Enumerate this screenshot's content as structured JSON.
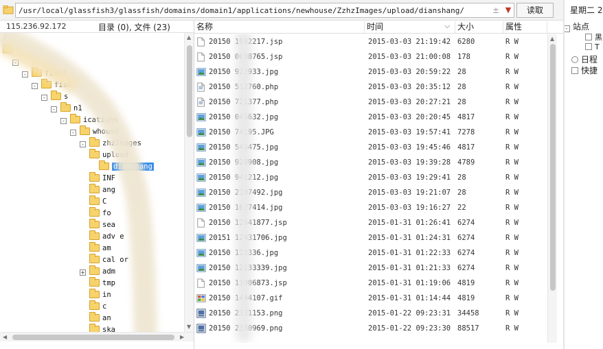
{
  "pathbar": {
    "path": "/usr/local/glassfish3/glassfish/domains/domain1/applications/newhouse/ZzhzImages/upload/dianshang/",
    "sync_icon": "sync-icon",
    "dropdown_icon": "chevron-down-icon",
    "read_button": "读取"
  },
  "left": {
    "server_ip": "115.236.92.172",
    "summary": "目录 (0), 文件 (23)"
  },
  "tree": [
    {
      "label": "/",
      "indent": 0,
      "expander": "",
      "folder": false
    },
    {
      "label": "",
      "indent": 0,
      "expander": "",
      "folder": true
    },
    {
      "label": "",
      "indent": 1,
      "expander": "-",
      "folder": false
    },
    {
      "label": "fish3",
      "indent": 2,
      "expander": "-",
      "folder": true
    },
    {
      "label": "fish",
      "indent": 3,
      "expander": "-",
      "folder": true
    },
    {
      "label": "s",
      "indent": 4,
      "expander": "-",
      "folder": true
    },
    {
      "label": "n1",
      "indent": 5,
      "expander": "-",
      "folder": true
    },
    {
      "label": "ications",
      "indent": 6,
      "expander": "-",
      "folder": true
    },
    {
      "label": "whouse",
      "indent": 7,
      "expander": "-",
      "folder": true
    },
    {
      "label": "zhzImages",
      "indent": 8,
      "expander": "-",
      "folder": true
    },
    {
      "label": "upload",
      "indent": 9,
      "expander": "",
      "folder": true
    },
    {
      "label": "dianshang",
      "indent": 10,
      "expander": "",
      "folder": true,
      "selected": true
    },
    {
      "label": "INF",
      "indent": 9,
      "expander": "",
      "folder": true
    },
    {
      "label": "ang",
      "indent": 9,
      "expander": "",
      "folder": true
    },
    {
      "label": "C",
      "indent": 9,
      "expander": "",
      "folder": true
    },
    {
      "label": "fo",
      "indent": 9,
      "expander": "",
      "folder": true
    },
    {
      "label": "sea",
      "indent": 9,
      "expander": "",
      "folder": true
    },
    {
      "label": "adv    e",
      "indent": 9,
      "expander": "",
      "folder": true
    },
    {
      "label": "am",
      "indent": 9,
      "expander": "",
      "folder": true
    },
    {
      "label": "cal    or",
      "indent": 9,
      "expander": "",
      "folder": true
    },
    {
      "label": "adm",
      "indent": 8,
      "expander": "+",
      "folder": true
    },
    {
      "label": "tmp",
      "indent": 9,
      "expander": "",
      "folder": true
    },
    {
      "label": "in",
      "indent": 9,
      "expander": "",
      "folder": true
    },
    {
      "label": "c",
      "indent": 9,
      "expander": "",
      "folder": true
    },
    {
      "label": "an",
      "indent": 9,
      "expander": "",
      "folder": true
    },
    {
      "label": "ska",
      "indent": 9,
      "expander": "",
      "folder": true
    }
  ],
  "columns": {
    "name": "名称",
    "time": "时间",
    "size": "大小",
    "attr": "属性",
    "sort_icon": "chevron-down-icon"
  },
  "files": [
    {
      "name": "20150    1942217.jsp",
      "time": "2015-03-03 21:19:42",
      "size": "6280",
      "attr": "R W",
      "icon": "file-icon"
    },
    {
      "name": "20150    0008765.jsp",
      "time": "2015-03-03 21:00:08",
      "size": "178",
      "attr": "R W",
      "icon": "file-icon"
    },
    {
      "name": "20150    922933.jpg",
      "time": "2015-03-03 20:59:22",
      "size": "28",
      "attr": "R W",
      "icon": "image-icon"
    },
    {
      "name": "20150    512760.php",
      "time": "2015-03-03 20:35:12",
      "size": "28",
      "attr": "R W",
      "icon": "script-file-icon"
    },
    {
      "name": "20150    721377.php",
      "time": "2015-03-03 20:27:21",
      "size": "28",
      "attr": "R W",
      "icon": "script-file-icon"
    },
    {
      "name": "20150    045632.jpg",
      "time": "2015-03-03 20:20:45",
      "size": "4817",
      "attr": "R W",
      "icon": "image-icon"
    },
    {
      "name": "20150    74195.JPG",
      "time": "2015-03-03 19:57:41",
      "size": "7278",
      "attr": "R W",
      "icon": "image-icon"
    },
    {
      "name": "20150    546475.jpg",
      "time": "2015-03-03 19:45:46",
      "size": "4817",
      "attr": "R W",
      "icon": "image-icon"
    },
    {
      "name": "20150    928908.jpg",
      "time": "2015-03-03 19:39:28",
      "size": "4789",
      "attr": "R W",
      "icon": "image-icon"
    },
    {
      "name": "20150    941212.jpg",
      "time": "2015-03-03 19:29:41",
      "size": "28",
      "attr": "R W",
      "icon": "image-icon"
    },
    {
      "name": "20150    2107492.jpg",
      "time": "2015-03-03 19:21:07",
      "size": "28",
      "attr": "R W",
      "icon": "image-icon"
    },
    {
      "name": "20150    1627414.jpg",
      "time": "2015-03-03 19:16:27",
      "size": "22",
      "attr": "R W",
      "icon": "image-icon"
    },
    {
      "name": "20150    12641877.jsp",
      "time": "2015-01-31 01:26:41",
      "size": "6274",
      "attr": "R W",
      "icon": "file-icon"
    },
    {
      "name": "20151    12431706.jpg",
      "time": "2015-01-31 01:24:31",
      "size": "6274",
      "attr": "R W",
      "icon": "image-icon"
    },
    {
      "name": "20150    122336.jpg",
      "time": "2015-01-31 01:22:33",
      "size": "6274",
      "attr": "R W",
      "icon": "image-icon"
    },
    {
      "name": "20150    12133339.jpg",
      "time": "2015-01-31 01:21:33",
      "size": "6274",
      "attr": "R W",
      "icon": "image-icon"
    },
    {
      "name": "20150    11906873.jsp",
      "time": "2015-01-31 01:19:06",
      "size": "4819",
      "attr": "R W",
      "icon": "file-icon"
    },
    {
      "name": "20150    1444107.gif",
      "time": "2015-01-31 01:14:44",
      "size": "4819",
      "attr": "R W",
      "icon": "gif-icon"
    },
    {
      "name": "20150    2331153.png",
      "time": "2015-01-22 09:23:31",
      "size": "34458",
      "attr": "R W",
      "icon": "png-icon"
    },
    {
      "name": "20150    2330969.png",
      "time": "2015-01-22 09:23:30",
      "size": "88517",
      "attr": "R W",
      "icon": "png-icon"
    }
  ],
  "right": {
    "date": "星期二 2",
    "items": [
      {
        "label": "站点",
        "icon": "minus-box-icon"
      },
      {
        "label": "黑",
        "icon": "blank-box-icon"
      },
      {
        "label": "T",
        "icon": "blank-box-icon"
      },
      {
        "label": "日程",
        "icon": "calendar-icon"
      },
      {
        "label": "快捷",
        "icon": "shortcut-icon"
      }
    ]
  },
  "colors": {
    "selection": "#3a8ee6",
    "folder": "#f7d36b",
    "folder_border": "#d8a22c"
  }
}
